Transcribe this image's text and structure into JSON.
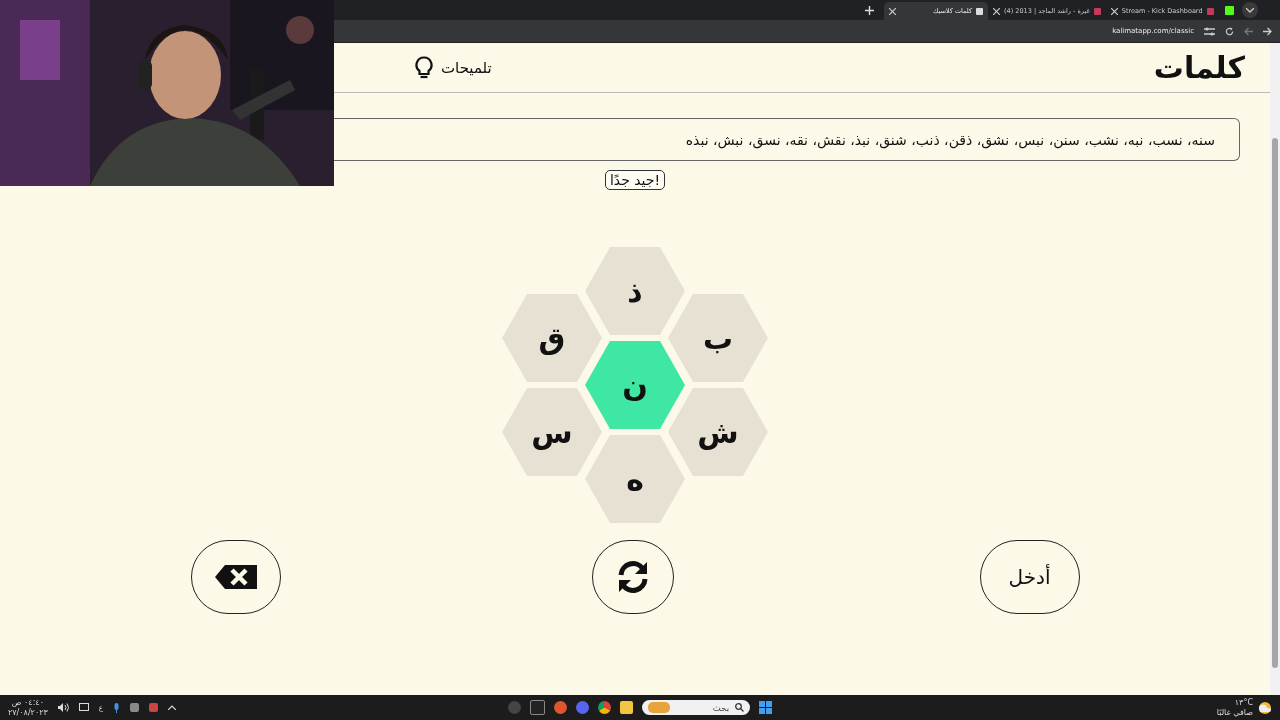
{
  "browser": {
    "tabs": [
      {
        "title": "Stream - Kick Dashboard",
        "selected": false
      },
      {
        "title": "(4) غيرة - راشد الماجد | 2013",
        "selected": false
      },
      {
        "title": "كلمات كلاسيك",
        "selected": true
      }
    ],
    "address": "kalimatapp.com/classic"
  },
  "header": {
    "title": "كلمات",
    "hints": "تلميحات"
  },
  "found_words": "سنه، نسب، نبه، نشب، سنن، نبس، نشق، ذقن، ذنب، شنق، نبذ، نقش، نقه، نسق، نبش، نبذه",
  "message": "جيد جدًا!",
  "letters": [
    {
      "letter": "ذ",
      "center": false
    },
    {
      "letter": "ق",
      "center": false
    },
    {
      "letter": "ب",
      "center": false
    },
    {
      "letter": "ن",
      "center": true
    },
    {
      "letter": "س",
      "center": false
    },
    {
      "letter": "ش",
      "center": false
    },
    {
      "letter": "ه",
      "center": false
    }
  ],
  "actions": {
    "enter": "أدخل"
  },
  "taskbar": {
    "time": "٠٤:٤٠ ص",
    "date": "٢٧/٠٨/٢٠٢٣",
    "language": "ع",
    "search_placeholder": "بحث",
    "temperature": "١٣°C",
    "weather": "صافي غالبًا"
  }
}
